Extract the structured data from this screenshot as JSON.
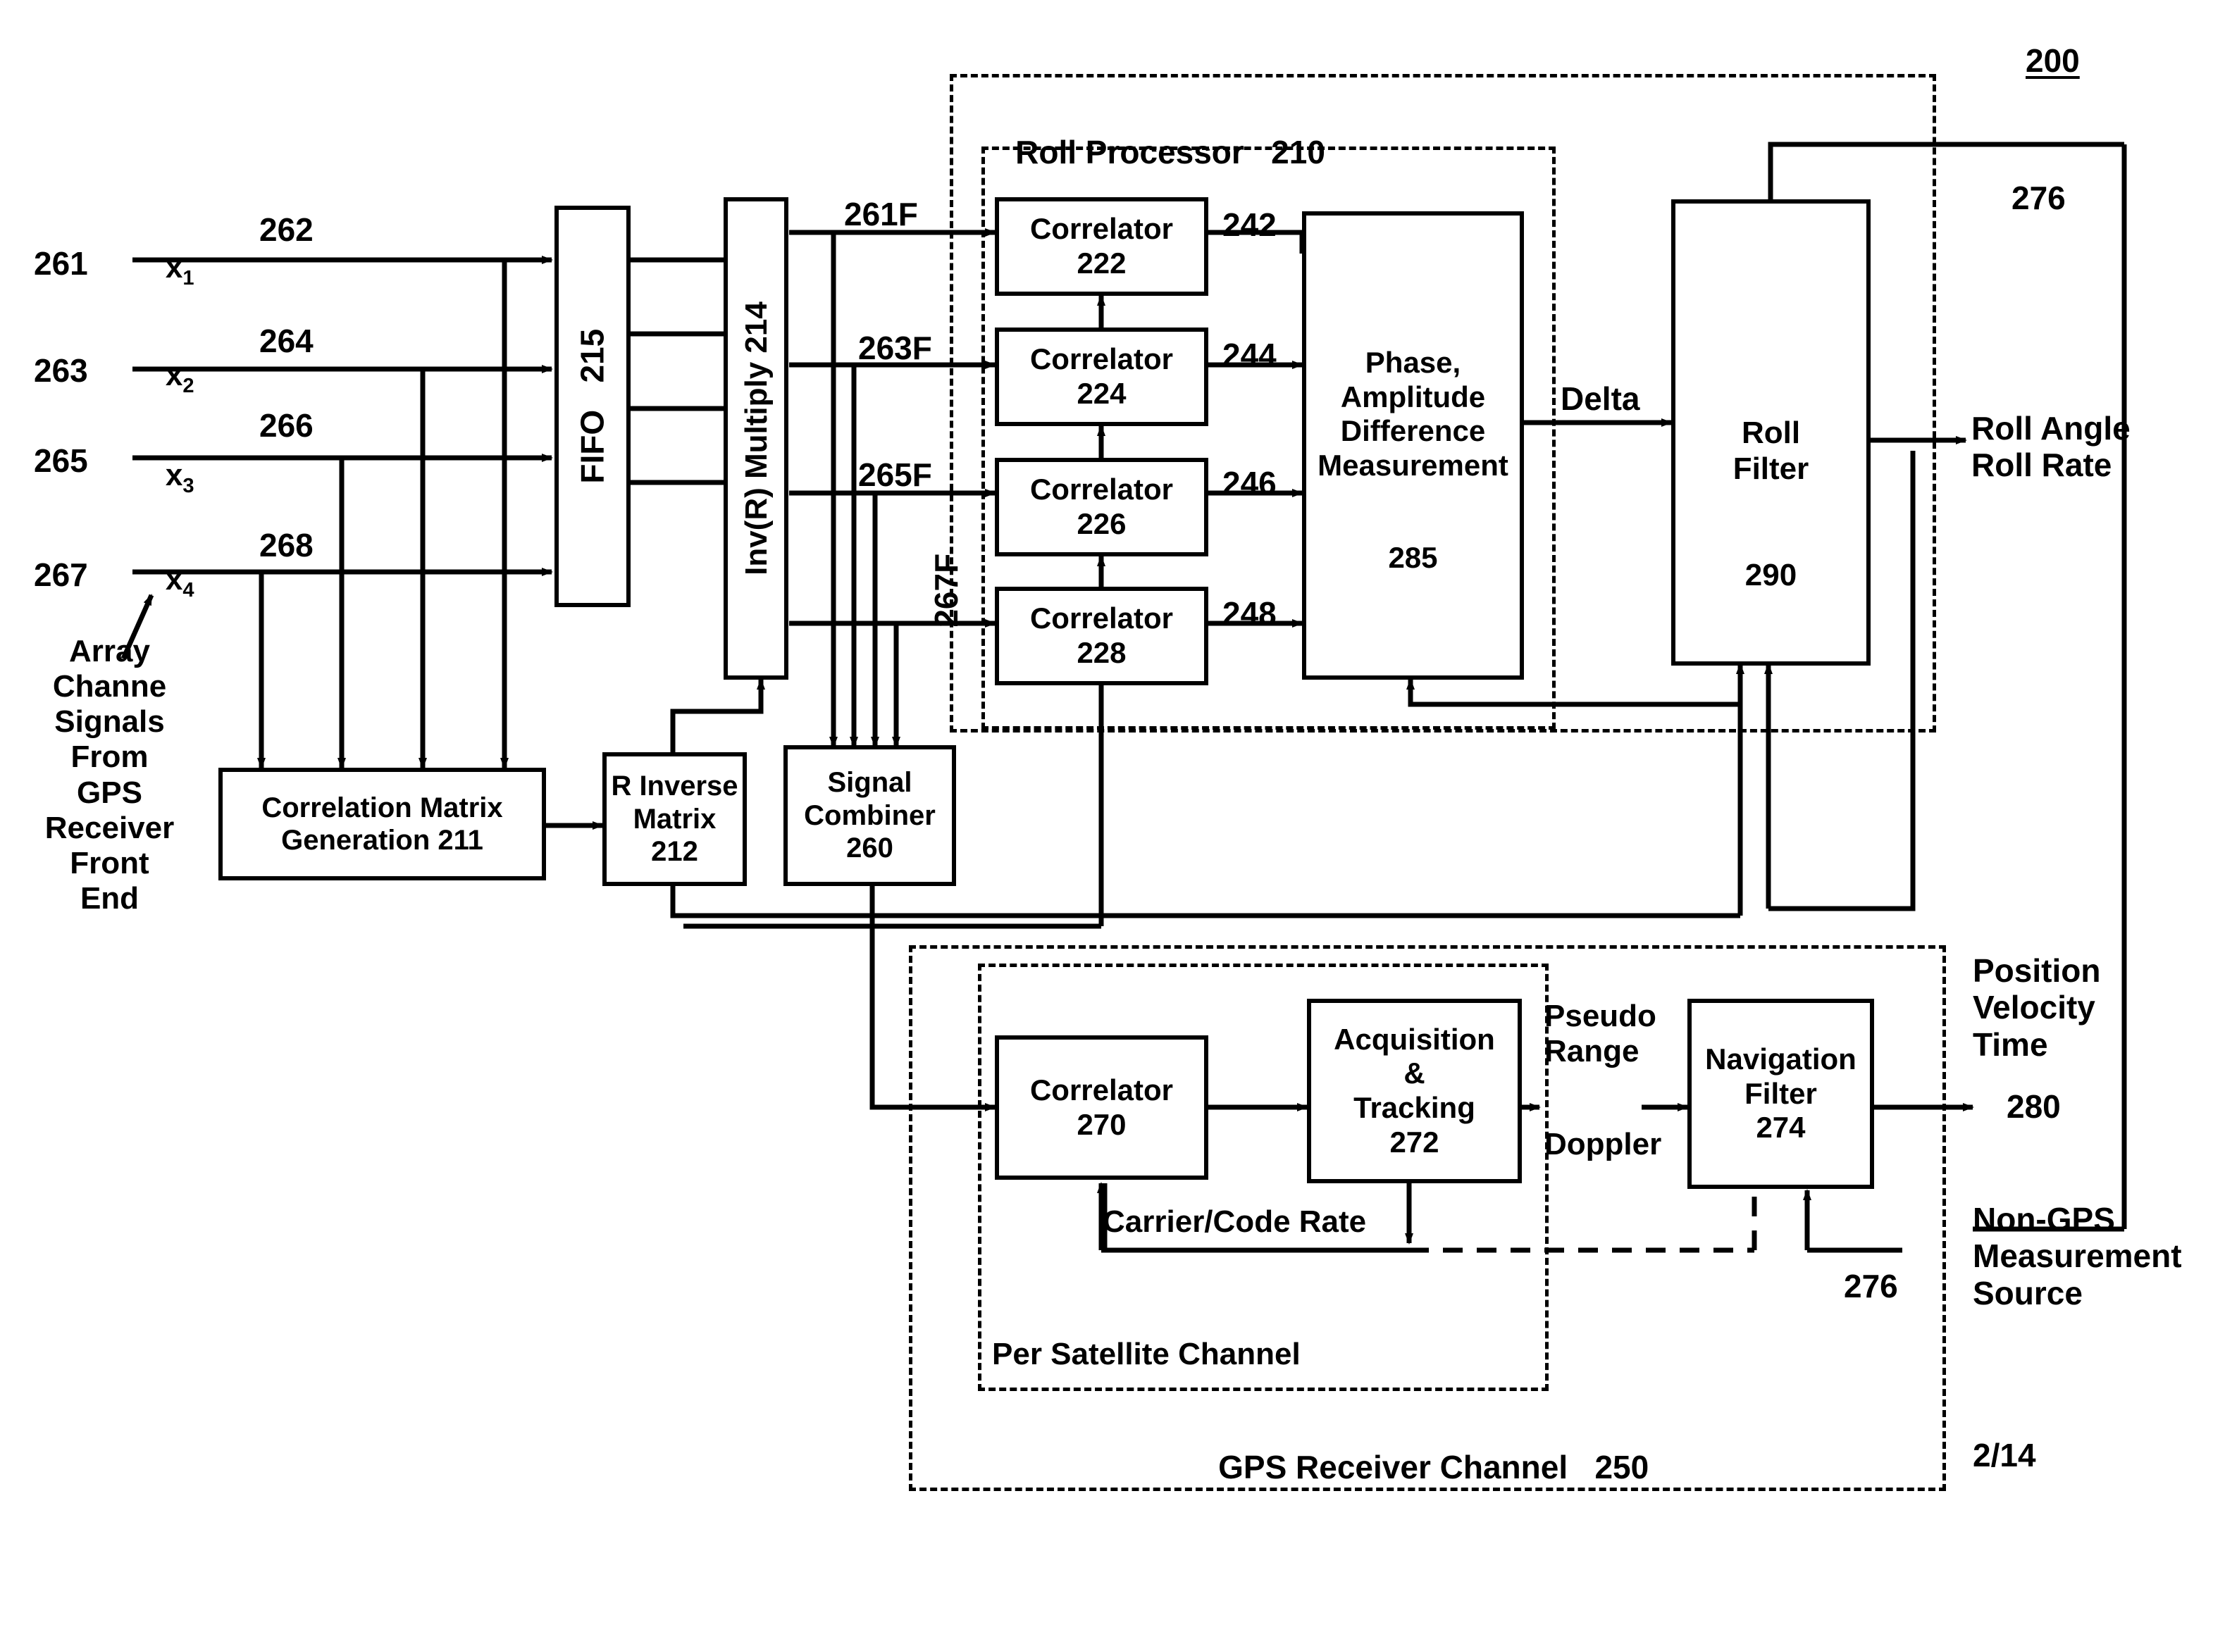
{
  "figure": {
    "number": "200",
    "sheet": "2/14"
  },
  "inputs": {
    "group_label": "Array\nChanne\nSignals\nFrom\nGPS\nReceiver\nFront\nEnd",
    "channels": [
      {
        "ref": "261",
        "signal": "x",
        "index": "1",
        "line_ref": "262"
      },
      {
        "ref": "263",
        "signal": "x",
        "index": "2",
        "line_ref": "264"
      },
      {
        "ref": "265",
        "signal": "x",
        "index": "3",
        "line_ref": "266"
      },
      {
        "ref": "267",
        "signal": "x",
        "index": "4",
        "line_ref": "268"
      }
    ]
  },
  "blocks": {
    "fifo": {
      "label": "FIFO",
      "ref": "215"
    },
    "inv_multiply": {
      "label": "Inv(R) Multiply",
      "ref": "214"
    },
    "correlation_matrix": {
      "line1": "Correlation Matrix",
      "line2": "Generation 211"
    },
    "r_inverse": {
      "line1": "R Inverse",
      "line2": "Matrix",
      "ref": "212"
    },
    "signal_combiner": {
      "line1": "Signal",
      "line2": "Combiner",
      "ref": "260"
    },
    "correlators_roll": [
      {
        "label": "Correlator",
        "ref": "222",
        "out_ref": "242",
        "in_ref": "261F"
      },
      {
        "label": "Correlator",
        "ref": "224",
        "out_ref": "244",
        "in_ref": "263F"
      },
      {
        "label": "Correlator",
        "ref": "226",
        "out_ref": "246",
        "in_ref": "265F"
      },
      {
        "label": "Correlator",
        "ref": "228",
        "out_ref": "248",
        "in_ref": "267F"
      }
    ],
    "phase_amplitude": {
      "line1": "Phase,",
      "line2": "Amplitude",
      "line3": "Difference",
      "line4": "Measurement",
      "ref": "285"
    },
    "roll_filter": {
      "line1": "Roll",
      "line2": "Filter",
      "ref": "290"
    },
    "correlator_gps": {
      "label": "Correlator",
      "ref": "270"
    },
    "acquisition_tracking": {
      "line1": "Acquisition",
      "line2": "&",
      "line3": "Tracking",
      "ref": "272"
    },
    "navigation_filter": {
      "line1": "Navigation",
      "line2": "Filter",
      "ref": "274"
    }
  },
  "containers": {
    "roll_processor": {
      "label": "Roll Processor",
      "ref": "210"
    },
    "per_satellite_channel": {
      "label": "Per Satellite Channel"
    },
    "gps_receiver_channel": {
      "label": "GPS Receiver Channel",
      "ref": "250"
    }
  },
  "signals": {
    "delta": "Delta",
    "carrier_code_rate": "Carrier/Code Rate",
    "pseudo_range": "Pseudo\nRange",
    "doppler": "Doppler",
    "feedback_top_ref": "276",
    "feedback_bottom_ref": "276"
  },
  "outputs": {
    "roll": "Roll Angle\nRoll Rate",
    "pvt": "Position\nVelocity\nTime",
    "pvt_ref": "280",
    "non_gps": "Non-GPS\nMeasurement\nSource"
  },
  "colors": {
    "ink": "#000000",
    "paper": "#ffffff"
  }
}
